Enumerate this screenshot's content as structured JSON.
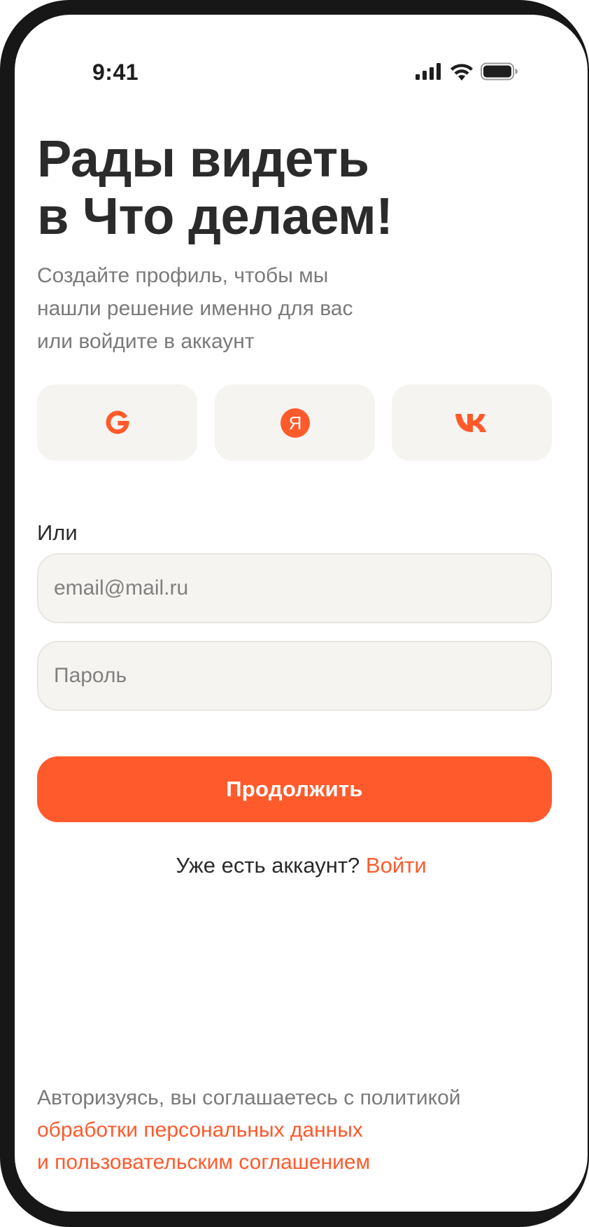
{
  "status_bar": {
    "time": "9:41",
    "icons": [
      "cellular-signal-icon",
      "wifi-icon",
      "battery-icon"
    ]
  },
  "heading": {
    "line1": "Рады видеть",
    "line2": "в Что делаем!"
  },
  "subtitle": {
    "line1": "Создайте профиль, чтобы мы",
    "line2": "нашли решение именно для вас",
    "line3": "или войдите в аккаунт"
  },
  "social_login": [
    {
      "icon": "google-icon",
      "accent": "#ff5a2c"
    },
    {
      "icon": "yandex-icon",
      "accent": "#ff5a2c",
      "glyph": "Я"
    },
    {
      "icon": "vk-icon",
      "accent": "#ff5a2c"
    }
  ],
  "or_label": "Или",
  "form": {
    "email_placeholder": "email@mail.ru",
    "email_value": "",
    "password_placeholder": "Пароль",
    "password_value": "",
    "continue_label": "Продолжить"
  },
  "login_prompt": {
    "text": "Уже есть аккаунт?",
    "link": "Войти"
  },
  "consent": {
    "text": "Авторизуясь, вы соглашаетесь с политикой",
    "link1": "обработки персональных данных",
    "link2": "и пользовательским соглашением"
  },
  "colors": {
    "accent": "#ff5a2c",
    "field_background": "#f6f4f0",
    "heading_text": "#2b2b2b",
    "secondary_text": "#7a7a7a",
    "device_frame": "#171717"
  }
}
